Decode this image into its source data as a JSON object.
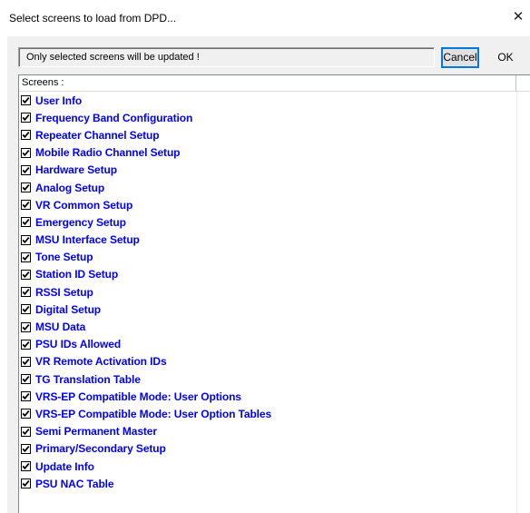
{
  "window": {
    "title": "Select screens to load from DPD...",
    "close_glyph": "✕"
  },
  "message": "Only selected screens will be updated !",
  "buttons": {
    "cancel": "Cancel",
    "ok": "OK"
  },
  "list": {
    "header": "Screens :",
    "items": [
      {
        "label": "User Info",
        "checked": true
      },
      {
        "label": "Frequency Band Configuration",
        "checked": true
      },
      {
        "label": "Repeater Channel Setup",
        "checked": true
      },
      {
        "label": "Mobile Radio Channel Setup",
        "checked": true
      },
      {
        "label": "Hardware Setup",
        "checked": true
      },
      {
        "label": "Analog Setup",
        "checked": true
      },
      {
        "label": "VR Common Setup",
        "checked": true
      },
      {
        "label": "Emergency Setup",
        "checked": true
      },
      {
        "label": "MSU Interface Setup",
        "checked": true
      },
      {
        "label": "Tone Setup",
        "checked": true
      },
      {
        "label": "Station ID Setup",
        "checked": true
      },
      {
        "label": "RSSI Setup",
        "checked": true
      },
      {
        "label": "Digital Setup",
        "checked": true
      },
      {
        "label": "MSU Data",
        "checked": true
      },
      {
        "label": "PSU IDs Allowed",
        "checked": true
      },
      {
        "label": "VR Remote Activation IDs",
        "checked": true
      },
      {
        "label": "TG Translation Table",
        "checked": true
      },
      {
        "label": "VRS-EP Compatible Mode: User Options",
        "checked": true
      },
      {
        "label": "VRS-EP Compatible Mode: User Option Tables",
        "checked": true
      },
      {
        "label": "Semi Permanent Master",
        "checked": true
      },
      {
        "label": "Primary/Secondary Setup",
        "checked": true
      },
      {
        "label": "Update Info",
        "checked": true
      },
      {
        "label": "PSU NAC Table",
        "checked": true
      }
    ]
  },
  "colors": {
    "item_text": "#0000ff",
    "dialog_bg": "#f0f0f0",
    "focus_border": "#0078d7"
  }
}
